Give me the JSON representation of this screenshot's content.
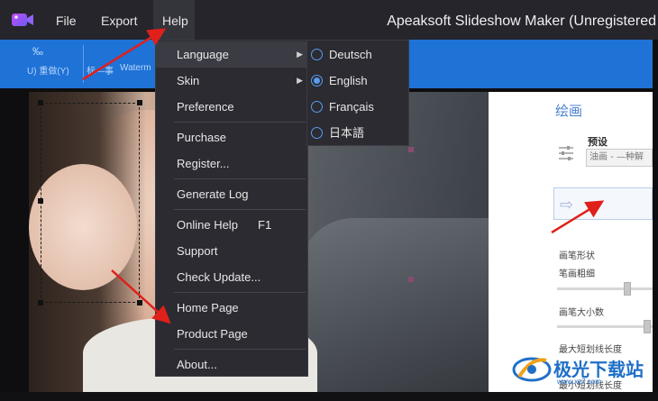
{
  "window": {
    "title": "Apeaksoft Slideshow Maker (Unregistered"
  },
  "menubar": {
    "items": [
      {
        "label": "File"
      },
      {
        "label": "Export"
      },
      {
        "label": "Help"
      }
    ]
  },
  "toolbar": {
    "left_text": "U) 重做(Y)",
    "watermark_text": "Waterm",
    "small_text": "‰",
    "mid_text": "标—事"
  },
  "help_menu": {
    "items": [
      {
        "label": "Language",
        "shortcut": ""
      },
      {
        "label": "Skin",
        "shortcut": ""
      },
      {
        "label": "Preference",
        "shortcut": ""
      },
      {
        "label": "Purchase",
        "shortcut": ""
      },
      {
        "label": "Register...",
        "shortcut": ""
      },
      {
        "label": "Generate Log",
        "shortcut": ""
      },
      {
        "label": "Online Help",
        "shortcut": "F1"
      },
      {
        "label": "Support",
        "shortcut": ""
      },
      {
        "label": "Check Update...",
        "shortcut": ""
      },
      {
        "label": "Home Page",
        "shortcut": ""
      },
      {
        "label": "Product Page",
        "shortcut": ""
      },
      {
        "label": "About...",
        "shortcut": ""
      }
    ],
    "highlighted": "Language"
  },
  "language_menu": {
    "items": [
      {
        "label": "Deutsch",
        "selected": false
      },
      {
        "label": "English",
        "selected": true
      },
      {
        "label": "Français",
        "selected": false
      },
      {
        "label": "日本語",
        "selected": false
      }
    ]
  },
  "paint_panel": {
    "title": "绘画",
    "preset_label": "预设",
    "preset_value": "油画 - —种解",
    "brush_shape": "画笔形状",
    "brush_thickness": "笔画粗细",
    "brush_size": "画笔大小数",
    "max_stroke": "最大短划线长度",
    "min_stroke": "最小短划线长度"
  },
  "watermark": {
    "text": "极光下载站",
    "sub": "www.xz7.com"
  },
  "colors": {
    "menubar": "#25252b",
    "menu_bg": "#2b2b31",
    "toolbar_blue": "#1f72d6",
    "radio_accent": "#5a9cf0",
    "annotation_red": "#e0201a"
  },
  "icons": {
    "logo": "app-logo-icon",
    "submenu_arrow": "chevron-right-icon",
    "radio": "radio-button-icon"
  }
}
